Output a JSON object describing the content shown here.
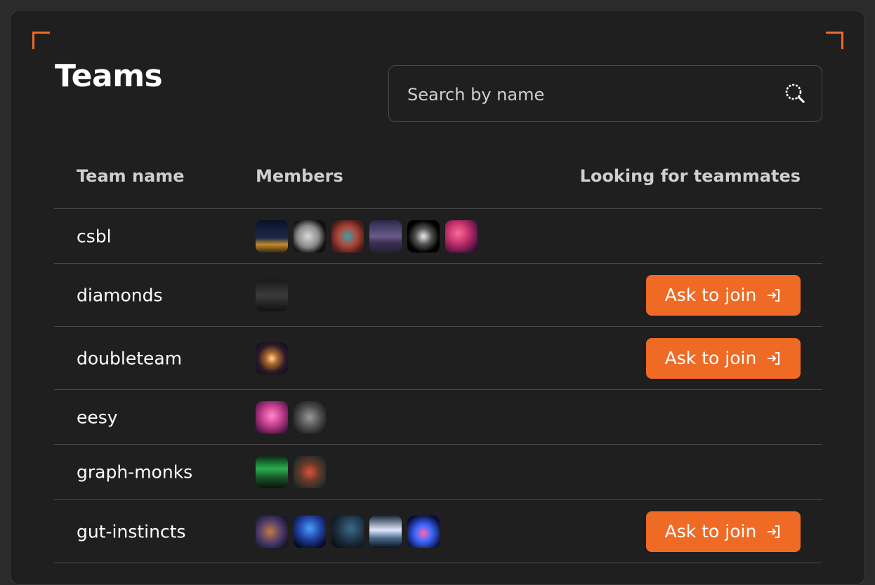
{
  "page": {
    "title": "Teams",
    "accent_color": "#ee6a25"
  },
  "search": {
    "placeholder": "Search by name",
    "value": "",
    "icon": "search-icon"
  },
  "table": {
    "headers": {
      "name": "Team name",
      "members": "Members",
      "looking": "Looking for teammates"
    },
    "join_label": "Ask to join",
    "join_icon": "sign-in-icon",
    "rows": [
      {
        "name": "csbl",
        "looking": false,
        "members": [
          {
            "bg": "linear-gradient(180deg,#0b1028 0%,#1e2a4a 55%,#c08a2a 75%,#3a2a10 100%)"
          },
          {
            "bg": "radial-gradient(circle at 45% 50%,#d8d8d8 0%,#8a8a8a 45%,#111 75%)"
          },
          {
            "bg": "radial-gradient(circle at 50% 50%,#3aa0b0 0%,#b04a3a 40%,#4a1a1a 80%)"
          },
          {
            "bg": "linear-gradient(180deg,#2a2a4a 0%,#6a5a8a 50%,#3a3050 70%,#222236 100%)"
          },
          {
            "bg": "radial-gradient(circle at 50% 50%,#eeeeee 0%,#555 35%,#000 70%)"
          },
          {
            "bg": "radial-gradient(circle at 40% 40%,#ff6a9a 0%,#c0306a 40%,#3a0a3a 85%)"
          }
        ]
      },
      {
        "name": "diamonds",
        "looking": true,
        "members": [
          {
            "bg": "linear-gradient(180deg,#1a1a1a 0%,#3a3a3a 50%,#111 100%)"
          }
        ]
      },
      {
        "name": "doubleteam",
        "looking": true,
        "members": [
          {
            "bg": "radial-gradient(ellipse at 50% 50%,#ffd9a0 0%,#b06a2a 25%,#2a1a2a 60%,#0a0a14 100%)"
          }
        ]
      },
      {
        "name": "eesy",
        "looking": false,
        "members": [
          {
            "bg": "radial-gradient(circle at 50% 45%,#ff8ac8 0%,#c03a8a 45%,#3a1040 90%)"
          },
          {
            "bg": "radial-gradient(circle at 50% 50%,#9a9a9a 0%,#4a4a4a 50%,#151515 90%)"
          }
        ]
      },
      {
        "name": "graph-monks",
        "looking": false,
        "members": [
          {
            "bg": "linear-gradient(180deg,#0a2a1a 0%,#2ab04a 40%,#1a5a2a 65%,#0a140a 100%)"
          },
          {
            "bg": "radial-gradient(circle at 50% 50%,#e0503a 0%,#6a3a2a 40%,#1a2a2a 85%)"
          }
        ]
      },
      {
        "name": "gut-instincts",
        "looking": true,
        "members": [
          {
            "bg": "radial-gradient(circle at 45% 50%,#c07a4a 0%,#4a3a6a 50%,#101020 90%)"
          },
          {
            "bg": "radial-gradient(circle at 50% 40%,#4aa0ff 0%,#2040a0 45%,#050a20 85%)"
          },
          {
            "bg": "radial-gradient(circle at 60% 40%,#3a6a8a 0%,#1a2a3a 55%,#05080c 95%)"
          },
          {
            "bg": "linear-gradient(180deg,#1a2a3a 0%,#dfe8ff 45%,#4a6a8a 70%,#0a1420 100%)"
          },
          {
            "bg": "radial-gradient(circle at 50% 55%,#ff6ab0 0%,#3a6aff 35%,#0a0a3a 80%)"
          }
        ]
      }
    ]
  }
}
